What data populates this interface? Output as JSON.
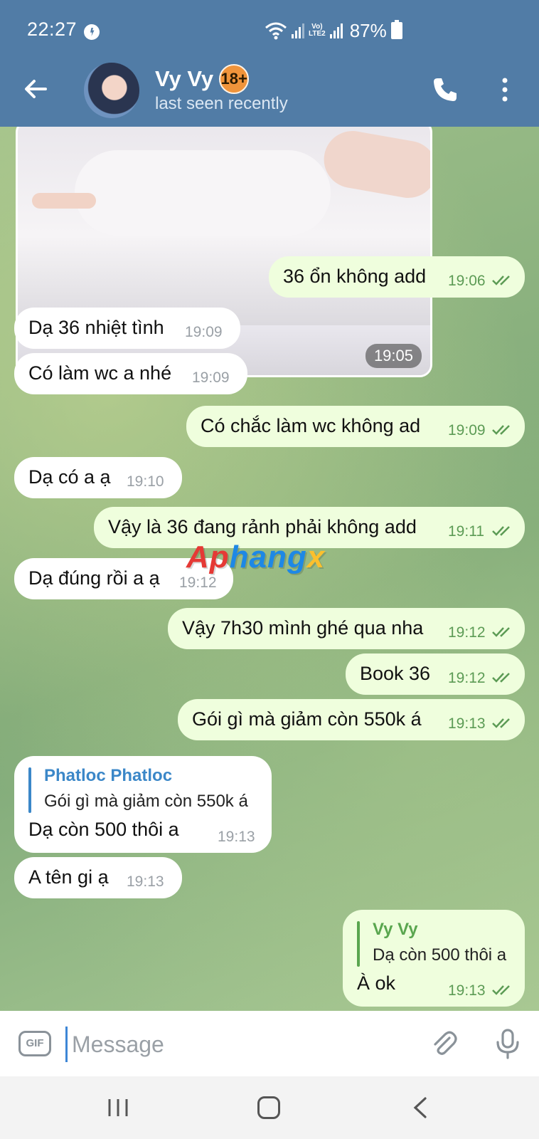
{
  "status_bar": {
    "time": "22:27",
    "volte_label": "Vo)\nLTE2",
    "battery_pct": "87%",
    "icons": [
      "messenger-icon",
      "wifi-icon",
      "signal-icon",
      "volte-icon",
      "battery-icon"
    ]
  },
  "header": {
    "name": "Vy Vy",
    "badge": "18+",
    "subtitle": "last seen recently",
    "icons": [
      "back-arrow-icon",
      "avatar",
      "phone-icon",
      "more-vertical-icon"
    ]
  },
  "photo": {
    "time": "19:05"
  },
  "messages": [
    {
      "dir": "out",
      "text": "36 ổn không add",
      "time": "19:06"
    },
    {
      "dir": "in",
      "text": "Dạ 36 nhiệt tình",
      "time": "19:09"
    },
    {
      "dir": "in",
      "text": "Có làm wc a nhé",
      "time": "19:09"
    },
    {
      "dir": "out",
      "text": "Có chắc làm wc không ad",
      "time": "19:09"
    },
    {
      "dir": "in",
      "text": "Dạ có a ạ",
      "time": "19:10"
    },
    {
      "dir": "out",
      "text": "Vậy là 36 đang rảnh phải không add",
      "time": "19:11"
    },
    {
      "dir": "in",
      "text": "Dạ đúng rồi a ạ",
      "time": "19:12"
    },
    {
      "dir": "out",
      "text": "Vậy 7h30 mình ghé qua nha",
      "time": "19:12"
    },
    {
      "dir": "out",
      "text": "Book 36",
      "time": "19:12"
    },
    {
      "dir": "out",
      "text": "Gói gì mà giảm còn 550k á",
      "time": "19:13"
    },
    {
      "dir": "in",
      "reply_name": "Phatloc Phatloc",
      "reply_text": "Gói gì mà giảm còn 550k á",
      "text": "Dạ còn 500 thôi a",
      "time": "19:13"
    },
    {
      "dir": "in",
      "text": "A tên gi ạ",
      "time": "19:13"
    },
    {
      "dir": "out",
      "reply_name": "Vy Vy",
      "reply_text": "Dạ còn 500 thôi a",
      "text": "À ok",
      "time": "19:13"
    }
  ],
  "watermark": {
    "part1": "Ap",
    "part2": "hang",
    "part3": "x"
  },
  "input": {
    "placeholder": "Message",
    "gif_label": "GIF"
  },
  "colors": {
    "header": "#517ca6",
    "outgoing_bubble": "#effedd",
    "incoming_bubble": "#ffffff",
    "outgoing_time": "#5c9b55",
    "reply_in_accent": "#3b87c8",
    "reply_out_accent": "#5aa64f"
  }
}
